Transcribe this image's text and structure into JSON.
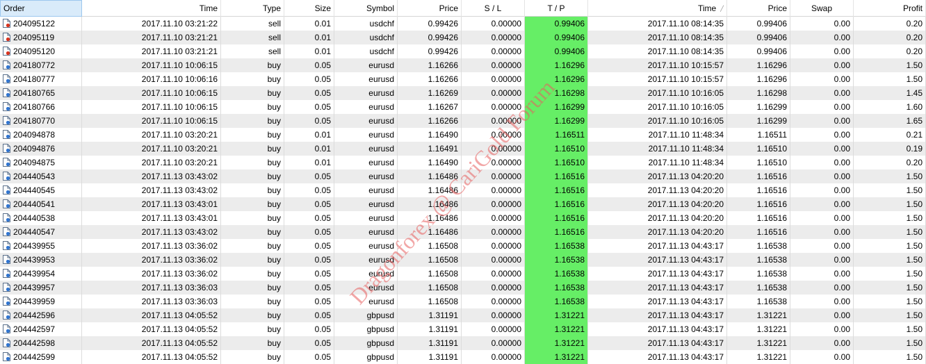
{
  "columns": [
    "Order",
    "Time",
    "Type",
    "Size",
    "Symbol",
    "Price",
    "S / L",
    "T / P",
    "Time",
    "Price",
    "Swap",
    "Profit"
  ],
  "colors": {
    "tp_highlight": "#66ee66",
    "header_selected": "#d9ebfa",
    "row_alt": "#ececec",
    "watermark": "#e85f5f"
  },
  "icons": {
    "sell": "order-sell-icon",
    "buy": "order-buy-icon"
  },
  "watermark": "Dragonforex @ CariGold Forum",
  "rows": [
    {
      "order": "204095122",
      "time": "2017.11.10 03:21:22",
      "type": "sell",
      "size": "0.01",
      "symbol": "usdchf",
      "price": "0.99426",
      "sl": "0.00000",
      "tp": "0.99406",
      "close_time": "2017.11.10 08:14:35",
      "close_price": "0.99406",
      "swap": "0.00",
      "profit": "0.20"
    },
    {
      "order": "204095119",
      "time": "2017.11.10 03:21:21",
      "type": "sell",
      "size": "0.01",
      "symbol": "usdchf",
      "price": "0.99426",
      "sl": "0.00000",
      "tp": "0.99406",
      "close_time": "2017.11.10 08:14:35",
      "close_price": "0.99406",
      "swap": "0.00",
      "profit": "0.20"
    },
    {
      "order": "204095120",
      "time": "2017.11.10 03:21:21",
      "type": "sell",
      "size": "0.01",
      "symbol": "usdchf",
      "price": "0.99426",
      "sl": "0.00000",
      "tp": "0.99406",
      "close_time": "2017.11.10 08:14:35",
      "close_price": "0.99406",
      "swap": "0.00",
      "profit": "0.20"
    },
    {
      "order": "204180772",
      "time": "2017.11.10 10:06:15",
      "type": "buy",
      "size": "0.05",
      "symbol": "eurusd",
      "price": "1.16266",
      "sl": "0.00000",
      "tp": "1.16296",
      "close_time": "2017.11.10 10:15:57",
      "close_price": "1.16296",
      "swap": "0.00",
      "profit": "1.50"
    },
    {
      "order": "204180777",
      "time": "2017.11.10 10:06:16",
      "type": "buy",
      "size": "0.05",
      "symbol": "eurusd",
      "price": "1.16266",
      "sl": "0.00000",
      "tp": "1.16296",
      "close_time": "2017.11.10 10:15:57",
      "close_price": "1.16296",
      "swap": "0.00",
      "profit": "1.50"
    },
    {
      "order": "204180765",
      "time": "2017.11.10 10:06:15",
      "type": "buy",
      "size": "0.05",
      "symbol": "eurusd",
      "price": "1.16269",
      "sl": "0.00000",
      "tp": "1.16298",
      "close_time": "2017.11.10 10:16:05",
      "close_price": "1.16298",
      "swap": "0.00",
      "profit": "1.45"
    },
    {
      "order": "204180766",
      "time": "2017.11.10 10:06:15",
      "type": "buy",
      "size": "0.05",
      "symbol": "eurusd",
      "price": "1.16267",
      "sl": "0.00000",
      "tp": "1.16299",
      "close_time": "2017.11.10 10:16:05",
      "close_price": "1.16299",
      "swap": "0.00",
      "profit": "1.60"
    },
    {
      "order": "204180770",
      "time": "2017.11.10 10:06:15",
      "type": "buy",
      "size": "0.05",
      "symbol": "eurusd",
      "price": "1.16266",
      "sl": "0.00000",
      "tp": "1.16299",
      "close_time": "2017.11.10 10:16:05",
      "close_price": "1.16299",
      "swap": "0.00",
      "profit": "1.65"
    },
    {
      "order": "204094878",
      "time": "2017.11.10 03:20:21",
      "type": "buy",
      "size": "0.01",
      "symbol": "eurusd",
      "price": "1.16490",
      "sl": "0.00000",
      "tp": "1.16511",
      "close_time": "2017.11.10 11:48:34",
      "close_price": "1.16511",
      "swap": "0.00",
      "profit": "0.21"
    },
    {
      "order": "204094876",
      "time": "2017.11.10 03:20:21",
      "type": "buy",
      "size": "0.01",
      "symbol": "eurusd",
      "price": "1.16491",
      "sl": "0.00000",
      "tp": "1.16510",
      "close_time": "2017.11.10 11:48:34",
      "close_price": "1.16510",
      "swap": "0.00",
      "profit": "0.19"
    },
    {
      "order": "204094875",
      "time": "2017.11.10 03:20:21",
      "type": "buy",
      "size": "0.01",
      "symbol": "eurusd",
      "price": "1.16490",
      "sl": "0.00000",
      "tp": "1.16510",
      "close_time": "2017.11.10 11:48:34",
      "close_price": "1.16510",
      "swap": "0.00",
      "profit": "0.20"
    },
    {
      "order": "204440543",
      "time": "2017.11.13 03:43:02",
      "type": "buy",
      "size": "0.05",
      "symbol": "eurusd",
      "price": "1.16486",
      "sl": "0.00000",
      "tp": "1.16516",
      "close_time": "2017.11.13 04:20:20",
      "close_price": "1.16516",
      "swap": "0.00",
      "profit": "1.50"
    },
    {
      "order": "204440545",
      "time": "2017.11.13 03:43:02",
      "type": "buy",
      "size": "0.05",
      "symbol": "eurusd",
      "price": "1.16486",
      "sl": "0.00000",
      "tp": "1.16516",
      "close_time": "2017.11.13 04:20:20",
      "close_price": "1.16516",
      "swap": "0.00",
      "profit": "1.50"
    },
    {
      "order": "204440541",
      "time": "2017.11.13 03:43:01",
      "type": "buy",
      "size": "0.05",
      "symbol": "eurusd",
      "price": "1.16486",
      "sl": "0.00000",
      "tp": "1.16516",
      "close_time": "2017.11.13 04:20:20",
      "close_price": "1.16516",
      "swap": "0.00",
      "profit": "1.50"
    },
    {
      "order": "204440538",
      "time": "2017.11.13 03:43:01",
      "type": "buy",
      "size": "0.05",
      "symbol": "eurusd",
      "price": "1.16486",
      "sl": "0.00000",
      "tp": "1.16516",
      "close_time": "2017.11.13 04:20:20",
      "close_price": "1.16516",
      "swap": "0.00",
      "profit": "1.50"
    },
    {
      "order": "204440547",
      "time": "2017.11.13 03:43:02",
      "type": "buy",
      "size": "0.05",
      "symbol": "eurusd",
      "price": "1.16486",
      "sl": "0.00000",
      "tp": "1.16516",
      "close_time": "2017.11.13 04:20:20",
      "close_price": "1.16516",
      "swap": "0.00",
      "profit": "1.50"
    },
    {
      "order": "204439955",
      "time": "2017.11.13 03:36:02",
      "type": "buy",
      "size": "0.05",
      "symbol": "eurusd",
      "price": "1.16508",
      "sl": "0.00000",
      "tp": "1.16538",
      "close_time": "2017.11.13 04:43:17",
      "close_price": "1.16538",
      "swap": "0.00",
      "profit": "1.50"
    },
    {
      "order": "204439953",
      "time": "2017.11.13 03:36:02",
      "type": "buy",
      "size": "0.05",
      "symbol": "eurusd",
      "price": "1.16508",
      "sl": "0.00000",
      "tp": "1.16538",
      "close_time": "2017.11.13 04:43:17",
      "close_price": "1.16538",
      "swap": "0.00",
      "profit": "1.50"
    },
    {
      "order": "204439954",
      "time": "2017.11.13 03:36:02",
      "type": "buy",
      "size": "0.05",
      "symbol": "eurusd",
      "price": "1.16508",
      "sl": "0.00000",
      "tp": "1.16538",
      "close_time": "2017.11.13 04:43:17",
      "close_price": "1.16538",
      "swap": "0.00",
      "profit": "1.50"
    },
    {
      "order": "204439957",
      "time": "2017.11.13 03:36:03",
      "type": "buy",
      "size": "0.05",
      "symbol": "eurusd",
      "price": "1.16508",
      "sl": "0.00000",
      "tp": "1.16538",
      "close_time": "2017.11.13 04:43:17",
      "close_price": "1.16538",
      "swap": "0.00",
      "profit": "1.50"
    },
    {
      "order": "204439959",
      "time": "2017.11.13 03:36:03",
      "type": "buy",
      "size": "0.05",
      "symbol": "eurusd",
      "price": "1.16508",
      "sl": "0.00000",
      "tp": "1.16538",
      "close_time": "2017.11.13 04:43:17",
      "close_price": "1.16538",
      "swap": "0.00",
      "profit": "1.50"
    },
    {
      "order": "204442596",
      "time": "2017.11.13 04:05:52",
      "type": "buy",
      "size": "0.05",
      "symbol": "gbpusd",
      "price": "1.31191",
      "sl": "0.00000",
      "tp": "1.31221",
      "close_time": "2017.11.13 04:43:17",
      "close_price": "1.31221",
      "swap": "0.00",
      "profit": "1.50"
    },
    {
      "order": "204442597",
      "time": "2017.11.13 04:05:52",
      "type": "buy",
      "size": "0.05",
      "symbol": "gbpusd",
      "price": "1.31191",
      "sl": "0.00000",
      "tp": "1.31221",
      "close_time": "2017.11.13 04:43:17",
      "close_price": "1.31221",
      "swap": "0.00",
      "profit": "1.50"
    },
    {
      "order": "204442598",
      "time": "2017.11.13 04:05:52",
      "type": "buy",
      "size": "0.05",
      "symbol": "gbpusd",
      "price": "1.31191",
      "sl": "0.00000",
      "tp": "1.31221",
      "close_time": "2017.11.13 04:43:17",
      "close_price": "1.31221",
      "swap": "0.00",
      "profit": "1.50"
    },
    {
      "order": "204442599",
      "time": "2017.11.13 04:05:52",
      "type": "buy",
      "size": "0.05",
      "symbol": "gbpusd",
      "price": "1.31191",
      "sl": "0.00000",
      "tp": "1.31221",
      "close_time": "2017.11.13 04:43:17",
      "close_price": "1.31221",
      "swap": "0.00",
      "profit": "1.50"
    }
  ]
}
